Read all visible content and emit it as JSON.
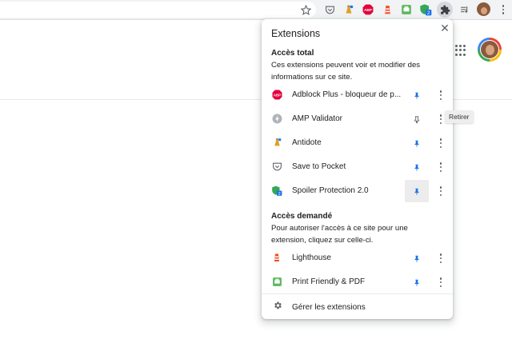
{
  "popup": {
    "title": "Extensions",
    "close_label": "✕",
    "full_access": {
      "heading": "Accès total",
      "description": "Ces extensions peuvent voir et modifier des informations sur ce site.",
      "items": [
        {
          "name": "Adblock Plus - bloqueur de p...",
          "icon": "adblock-plus-icon",
          "pinned": true
        },
        {
          "name": "AMP Validator",
          "icon": "amp-validator-icon",
          "pinned": false
        },
        {
          "name": "Antidote",
          "icon": "antidote-icon",
          "pinned": true
        },
        {
          "name": "Save to Pocket",
          "icon": "pocket-icon",
          "pinned": true
        },
        {
          "name": "Spoiler Protection 2.0",
          "icon": "spoiler-protection-icon",
          "pinned": true,
          "badge": "2"
        }
      ]
    },
    "requested_access": {
      "heading": "Accès demandé",
      "description": "Pour autoriser l'accès à ce site pour une extension, cliquez sur celle-ci.",
      "items": [
        {
          "name": "Lighthouse",
          "icon": "lighthouse-icon",
          "pinned": true
        },
        {
          "name": "Print Friendly & PDF",
          "icon": "print-friendly-icon",
          "pinned": true
        }
      ]
    },
    "manage_label": "Gérer les extensions"
  },
  "tooltip": "Retirer",
  "toolbar": {
    "abp_text": "ABP",
    "spoiler_badge": "2"
  },
  "colors": {
    "pin_blue": "#1a73e8",
    "pin_gray": "#5f6368",
    "abp_red": "#e4003b",
    "pocket": "#ef4056",
    "green": "#34a853"
  }
}
